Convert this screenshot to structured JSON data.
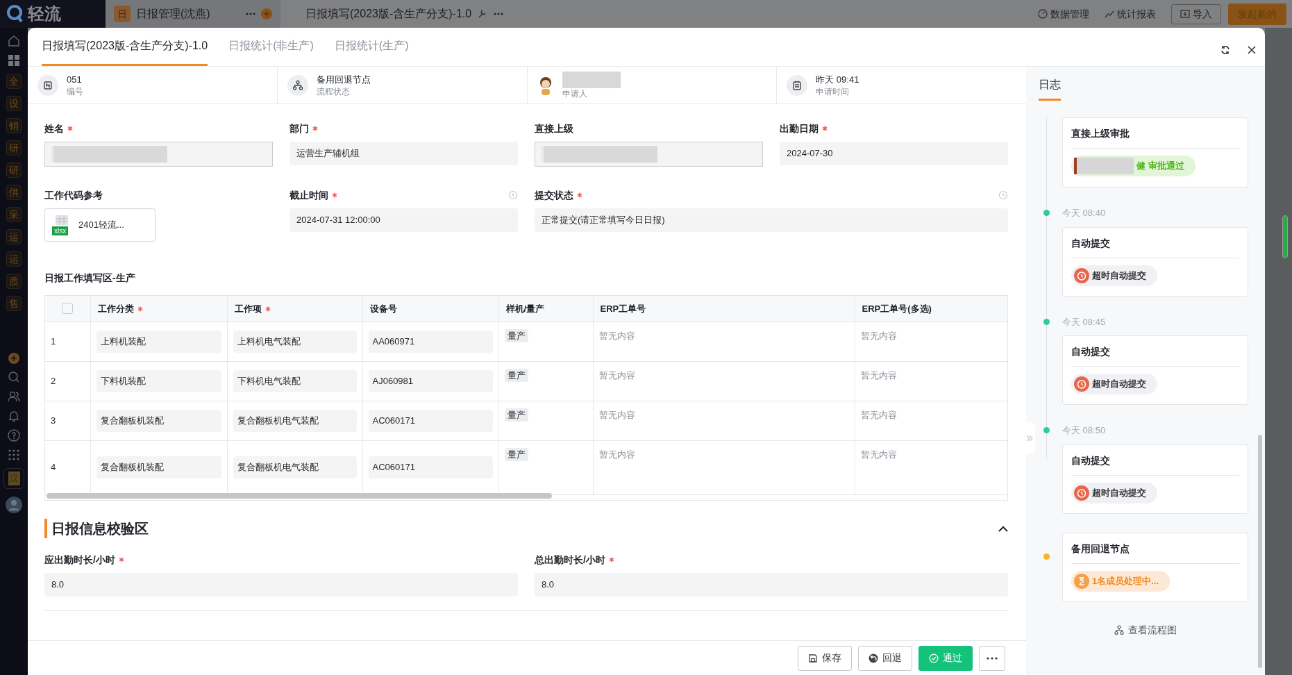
{
  "app": {
    "logo": "轻流",
    "tab": {
      "icon_char": "日",
      "label": "日报管理(沈燕)"
    },
    "title": "日报填写(2023版-含生产分支)-1.0",
    "actions": [
      "数据管理",
      "统计报表"
    ],
    "import_button": "导入",
    "new_button": "发起新的",
    "sidebar_items": [
      "全",
      "设",
      "销",
      "研",
      "研",
      "供",
      "采",
      "运",
      "运",
      "质",
      "售"
    ],
    "sidebar_badge": "汉"
  },
  "modal": {
    "tabs": [
      {
        "label": "日报填写(2023版-含生产分支)-1.0",
        "selected": true
      },
      {
        "label": "日报统计(非生产)",
        "selected": false
      },
      {
        "label": "日报统计(生产)",
        "selected": false
      }
    ],
    "info": [
      {
        "kind": "number",
        "value": "051",
        "label": "编号"
      },
      {
        "kind": "flow",
        "value": "备用回退节点",
        "label": "流程状态"
      },
      {
        "kind": "person",
        "label": "申请人"
      },
      {
        "kind": "time",
        "value": "昨天 09:41",
        "label": "申请时间"
      }
    ],
    "fields": [
      {
        "kind": "redacted",
        "label": "姓名",
        "required": true
      },
      {
        "kind": "text",
        "label": "部门",
        "required": true,
        "value": "运营生产辅机组"
      },
      {
        "kind": "redacted",
        "label": "直接上级",
        "required": false
      },
      {
        "kind": "text",
        "label": "出勤日期",
        "required": true,
        "value": "2024-07-30"
      },
      {
        "kind": "file",
        "label": "工作代码参考",
        "required": false,
        "file_type": "xlsx",
        "file_name": "2401轻流..."
      },
      {
        "kind": "text",
        "label": "截止时间",
        "required": true,
        "value": "2024-07-31 12:00:00",
        "history": true
      },
      {
        "kind": "text",
        "label": "提交状态",
        "required": true,
        "value": "正常提交(请正常填写今日日报)",
        "history": true,
        "wide": true
      }
    ],
    "table": {
      "title": "日报工作填写区-生产",
      "select_all": false,
      "columns": [
        {
          "label": "工作分类",
          "required": true
        },
        {
          "label": "工作项",
          "required": true
        },
        {
          "label": "设备号",
          "required": false
        },
        {
          "label": "样机/量产",
          "required": false
        },
        {
          "label": "ERP工单号",
          "required": false
        },
        {
          "label": "ERP工单号(多选)",
          "required": false
        }
      ],
      "rows": [
        {
          "index": "1",
          "cells": [
            {
              "kind": "box",
              "text": "上料机装配"
            },
            {
              "kind": "box",
              "text": "上料机电气装配"
            },
            {
              "kind": "box",
              "text": "AA060971"
            },
            {
              "kind": "tag",
              "text": "量产"
            },
            {
              "kind": "empty",
              "text": "暂无内容"
            },
            {
              "kind": "empty",
              "text": "暂无内容"
            }
          ]
        },
        {
          "index": "2",
          "cells": [
            {
              "kind": "box",
              "text": "下料机装配"
            },
            {
              "kind": "box",
              "text": "下料机电气装配"
            },
            {
              "kind": "box",
              "text": "AJ060981"
            },
            {
              "kind": "tag",
              "text": "量产"
            },
            {
              "kind": "empty",
              "text": "暂无内容"
            },
            {
              "kind": "empty",
              "text": "暂无内容"
            }
          ]
        },
        {
          "index": "3",
          "cells": [
            {
              "kind": "box",
              "text": "复合翻板机装配"
            },
            {
              "kind": "box",
              "text": "复合翻板机电气装配"
            },
            {
              "kind": "box",
              "text": "AC060171"
            },
            {
              "kind": "tag",
              "text": "量产"
            },
            {
              "kind": "empty",
              "text": "暂无内容"
            },
            {
              "kind": "empty",
              "text": "暂无内容"
            }
          ]
        },
        {
          "index": "4",
          "cells": [
            {
              "kind": "box",
              "text": "复合翻板机装配"
            },
            {
              "kind": "box",
              "text": "复合翻板机电气装配"
            },
            {
              "kind": "box",
              "text": "AC060171"
            },
            {
              "kind": "tag",
              "text": "量产"
            },
            {
              "kind": "empty",
              "text": "暂无内容"
            },
            {
              "kind": "empty",
              "text": "暂无内容"
            }
          ]
        }
      ]
    },
    "section": {
      "title": "日报信息校验区",
      "expanded": true,
      "fields": [
        {
          "label": "应出勤时长/小时",
          "required": true,
          "value": "8.0"
        },
        {
          "label": "总出勤时长/小时",
          "required": true,
          "value": "8.0"
        }
      ]
    },
    "buttons": [
      {
        "kind": "save",
        "label": "保存"
      },
      {
        "kind": "rollback",
        "label": "回退"
      },
      {
        "kind": "approve",
        "label": "通过"
      },
      {
        "kind": "more"
      }
    ],
    "log": {
      "title": "日志",
      "entries": [
        {
          "title": "直接上级审批",
          "status": {
            "kind": "approved",
            "name_suffix": "健",
            "text": "审批通过"
          }
        },
        {
          "time": "今天 08:40",
          "color": "#2ecc9a",
          "title": "自动提交",
          "status": {
            "kind": "timeout",
            "text": "超时自动提交"
          }
        },
        {
          "time": "今天 08:45",
          "color": "#2ecc9a",
          "title": "自动提交",
          "status": {
            "kind": "timeout",
            "text": "超时自动提交"
          }
        },
        {
          "time": "今天 08:50",
          "color": "#2ecc9a",
          "title": "自动提交",
          "status": {
            "kind": "timeout",
            "text": "超时自动提交"
          }
        },
        {
          "color": "#f5b622",
          "title": "备用回退节点",
          "status": {
            "kind": "pending",
            "text": "1名成员处理中..."
          }
        }
      ],
      "flow_link": "查看流程图"
    }
  }
}
